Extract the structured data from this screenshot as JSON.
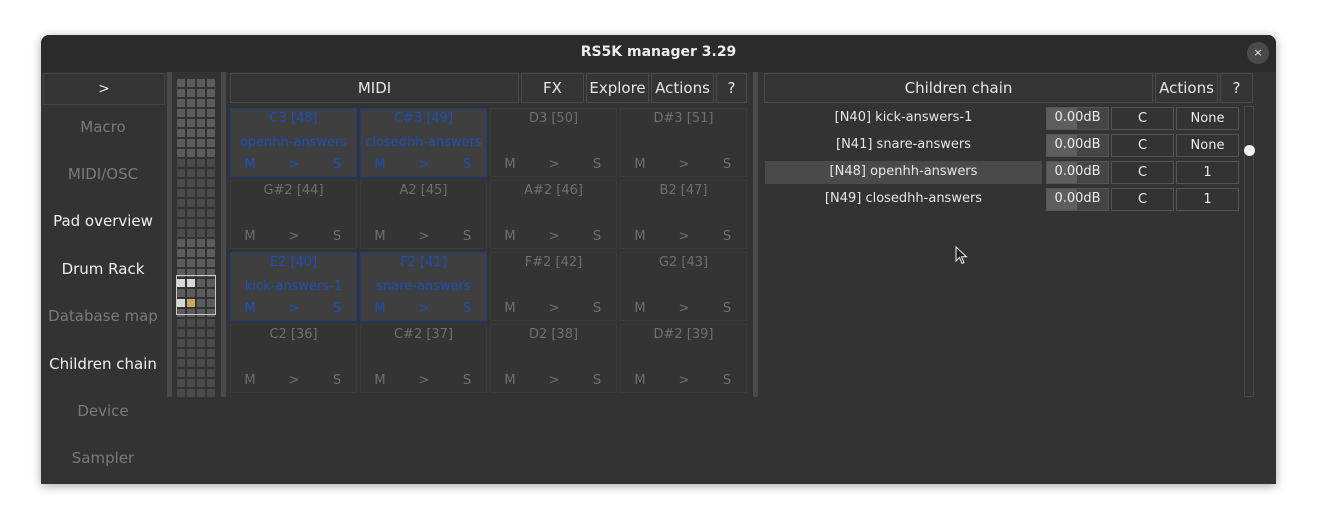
{
  "window": {
    "title": "RS5K manager 3.29",
    "close_glyph": "×"
  },
  "sidebar": {
    "toggle_label": ">",
    "items": [
      {
        "label": "Macro",
        "active": false
      },
      {
        "label": "MIDI/OSC",
        "active": false
      },
      {
        "label": "Pad overview",
        "active": true
      },
      {
        "label": "Drum Rack",
        "active": true
      },
      {
        "label": "Database map",
        "active": false
      },
      {
        "label": "Children chain",
        "active": true
      },
      {
        "label": "Device",
        "active": false
      },
      {
        "label": "Sampler",
        "active": false
      }
    ]
  },
  "rack_toolbar": {
    "midi": "MIDI",
    "fx": "FX",
    "explore": "Explore",
    "actions": "Actions",
    "help": "?"
  },
  "pads": {
    "button_labels": {
      "mute": "M",
      "play": ">",
      "solo": "S"
    },
    "rows": [
      [
        {
          "note": "C3 [48]",
          "name": "openhh-answers",
          "filled": true
        },
        {
          "note": "C#3 [49]",
          "name": "closedhh-answers",
          "filled": true
        },
        {
          "note": "D3 [50]",
          "name": "",
          "filled": false
        },
        {
          "note": "D#3 [51]",
          "name": "",
          "filled": false
        }
      ],
      [
        {
          "note": "G#2 [44]",
          "name": "",
          "filled": false
        },
        {
          "note": "A2 [45]",
          "name": "",
          "filled": false
        },
        {
          "note": "A#2 [46]",
          "name": "",
          "filled": false
        },
        {
          "note": "B2 [47]",
          "name": "",
          "filled": false
        }
      ],
      [
        {
          "note": "E2 [40]",
          "name": "kick-answers-1",
          "filled": true
        },
        {
          "note": "F2 [41]",
          "name": "snare-answers",
          "filled": true
        },
        {
          "note": "F#2 [42]",
          "name": "",
          "filled": false
        },
        {
          "note": "G2 [43]",
          "name": "",
          "filled": false
        }
      ],
      [
        {
          "note": "C2 [36]",
          "name": "",
          "filled": false
        },
        {
          "note": "C#2 [37]",
          "name": "",
          "filled": false
        },
        {
          "note": "D2 [38]",
          "name": "",
          "filled": false
        },
        {
          "note": "D#2 [39]",
          "name": "",
          "filled": false
        }
      ]
    ]
  },
  "children_chain": {
    "header": "Children chain",
    "actions": "Actions",
    "help": "?",
    "rows": [
      {
        "name": "[N40] kick-answers-1",
        "volume": "0.00dB",
        "c": "C",
        "choke": "None",
        "highlighted": false
      },
      {
        "name": "[N41] snare-answers",
        "volume": "0.00dB",
        "c": "C",
        "choke": "None",
        "highlighted": false
      },
      {
        "name": "[N48] openhh-answers",
        "volume": "0.00dB",
        "c": "C",
        "choke": "1",
        "highlighted": true
      },
      {
        "name": "[N49] closedhh-answers",
        "volume": "0.00dB",
        "c": "C",
        "choke": "1",
        "highlighted": false
      }
    ]
  },
  "colors": {
    "pad_filled_text": "#1d4fb5",
    "pad_filled_border": "#1b3f86",
    "background": "#333333"
  },
  "icons": {
    "close": "close-icon",
    "cursor": "mouse-pointer-icon"
  }
}
